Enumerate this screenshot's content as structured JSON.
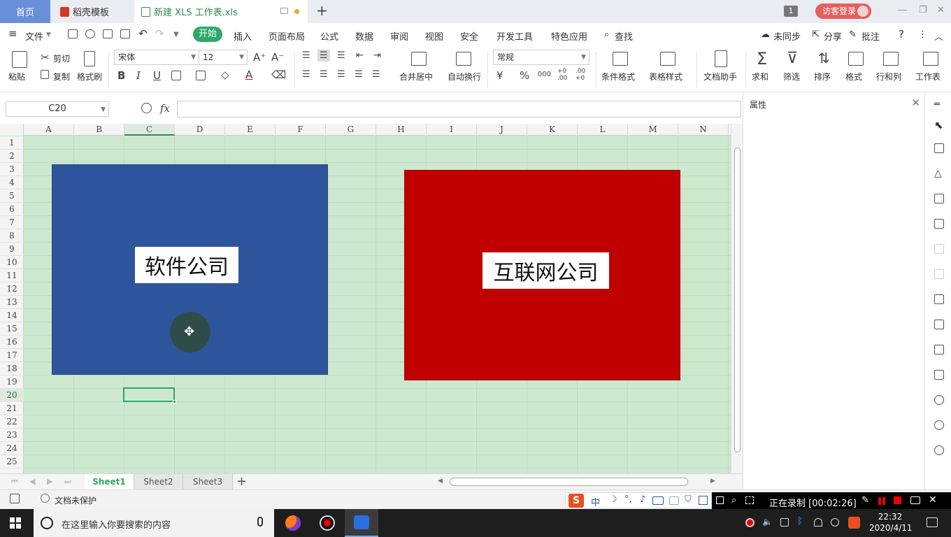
{
  "tabs": {
    "home": "首页",
    "template": "稻壳模板",
    "document": "新建 XLS 工作表.xls",
    "add": "+"
  },
  "window": {
    "count_badge": "1",
    "login": "访客登录",
    "minimize": "—",
    "restore": "❐",
    "close": "✕"
  },
  "menu": {
    "file": "文件",
    "items": [
      "开始",
      "插入",
      "页面布局",
      "公式",
      "数据",
      "审阅",
      "视图",
      "安全",
      "开发工具",
      "特色应用"
    ],
    "search": "查找",
    "sync": "未同步",
    "share": "分享",
    "comment": "批注",
    "help": "?",
    "more": "⋮",
    "collapse": "︿"
  },
  "ribbon": {
    "paste": "粘贴",
    "cut": "剪切",
    "copy": "复制",
    "format_painter": "格式刷",
    "font_name": "宋体",
    "font_size": "12",
    "increase_font": "A⁺",
    "decrease_font": "A⁻",
    "bold": "B",
    "italic": "I",
    "underline": "U",
    "font_color_glyph": "A",
    "merge_center": "合并居中",
    "wrap_text": "自动换行",
    "number_format": "常规",
    "currency": "¥",
    "percent": "%",
    "thousands": "000",
    "inc_decimal": "+0 .00",
    "dec_decimal": ".00 +0",
    "conditional_format": "条件格式",
    "table_style": "表格样式",
    "doc_assistant": "文档助手",
    "sum": "求和",
    "filter": "筛选",
    "sort": "排序",
    "format": "格式",
    "row_col": "行和列",
    "worksheet": "工作表"
  },
  "formula_bar": {
    "name_box": "C20",
    "fx": "fx",
    "value": ""
  },
  "properties": {
    "title": "属性",
    "close": "✕"
  },
  "grid": {
    "columns": [
      "A",
      "B",
      "C",
      "D",
      "E",
      "F",
      "G",
      "H",
      "I",
      "J",
      "K",
      "L",
      "M",
      "N"
    ],
    "active_column": "C",
    "rows": [
      "1",
      "2",
      "3",
      "4",
      "5",
      "6",
      "7",
      "8",
      "9",
      "10",
      "11",
      "12",
      "13",
      "14",
      "15",
      "16",
      "17",
      "18",
      "19",
      "20",
      "21",
      "22",
      "23",
      "24",
      "25"
    ],
    "active_row": "20",
    "background_color": "#cce8cf"
  },
  "shapes": {
    "software": {
      "label": "软件公司",
      "color": "#2e549c"
    },
    "internet": {
      "label": "互联网公司",
      "color": "#c00000"
    }
  },
  "sheets": [
    "Sheet1",
    "Sheet2",
    "Sheet3"
  ],
  "active_sheet": "Sheet1",
  "add_sheet": "+",
  "status": {
    "protection": "文档未保护",
    "ime_mode": "中",
    "recording": "正在录制 [00:02:26]"
  },
  "taskbar": {
    "search_placeholder": "在这里输入你要搜索的内容",
    "time": "22:32",
    "date": "2020/4/11"
  },
  "accent_color": "#2ea866"
}
